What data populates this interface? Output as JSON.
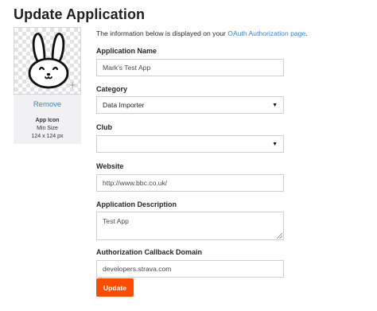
{
  "page": {
    "title": "Update Application"
  },
  "icon_panel": {
    "remove_label": "Remove",
    "caption_title": "App Icon",
    "caption_min": "Min Size",
    "caption_size": "124 x 124 px",
    "plus_symbol": "+"
  },
  "intro": {
    "text": "The information below is displayed on your ",
    "link": "OAuth Authorization page",
    "suffix": "."
  },
  "form": {
    "app_name_label": "Application Name",
    "app_name_value": "Mark's Test App",
    "category_label": "Category",
    "category_value": "Data Importer",
    "club_label": "Club",
    "club_value": "",
    "website_label": "Website",
    "website_value": "http://www.bbc.co.uk/",
    "description_label": "Application Description",
    "description_value": "Test App",
    "callback_label": "Authorization Callback Domain",
    "callback_value": "developers.strava.com",
    "dropdown_arrow": "▼",
    "submit_label": "Update"
  },
  "colors": {
    "accent": "#fc4c02",
    "link": "#3d82c4"
  }
}
